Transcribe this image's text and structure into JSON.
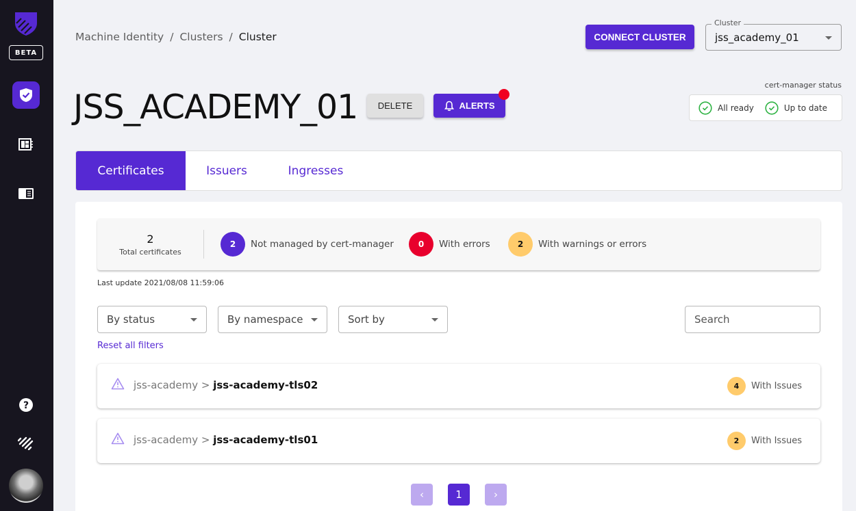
{
  "sidebar": {
    "beta_label": "BETA",
    "items": [
      {
        "name": "certificates-shield",
        "icon": "shield-check-icon",
        "active": true
      },
      {
        "name": "dashboard",
        "icon": "dashboard-icon",
        "active": false
      },
      {
        "name": "docs",
        "icon": "book-icon",
        "active": false
      }
    ],
    "bottom": [
      "help-icon",
      "jetstack-logo-icon",
      "avatar"
    ]
  },
  "breadcrumb": {
    "items": [
      "Machine Identity",
      "Clusters",
      "Cluster"
    ],
    "separator": "/"
  },
  "header": {
    "connect_label": "CONNECT CLUSTER",
    "cluster_select": {
      "label": "Cluster",
      "value": "jss_academy_01"
    },
    "title": "JSS_ACADEMY_01",
    "delete_label": "DELETE",
    "alerts_label": "ALERTS",
    "cert_manager": {
      "label": "cert-manager status",
      "items": [
        "All ready",
        "Up to date"
      ]
    }
  },
  "tabs": [
    {
      "label": "Certificates",
      "active": true
    },
    {
      "label": "Issuers",
      "active": false
    },
    {
      "label": "Ingresses",
      "active": false
    }
  ],
  "summary": {
    "total": "2",
    "total_label": "Total certificates",
    "stats": [
      {
        "count": "2",
        "label": "Not managed by cert-manager",
        "color": "#5629d3"
      },
      {
        "count": "0",
        "label": "With errors",
        "color": "#e8002d"
      },
      {
        "count": "2",
        "label": "With warnings or errors",
        "color": "#ffcb6b"
      }
    ],
    "last_update": "Last update 2021/08/08 11:59:06"
  },
  "filters": {
    "status": "By status",
    "namespace": "By namespace",
    "sort": "Sort by",
    "search_placeholder": "Search",
    "reset_label": "Reset all filters"
  },
  "certificates": [
    {
      "namespace": "jss-academy",
      "separator": ">",
      "name": "jss-academy-tls02",
      "issues": "4",
      "issues_label": "With Issues"
    },
    {
      "namespace": "jss-academy",
      "separator": ">",
      "name": "jss-academy-tls01",
      "issues": "2",
      "issues_label": "With Issues"
    }
  ],
  "pagination": {
    "prev": "‹",
    "current": "1",
    "next": "›"
  },
  "colors": {
    "accent": "#5629d3",
    "sidebar": "#17151f",
    "error": "#e8002d",
    "warning": "#ffcb6b",
    "ok": "#2fb344"
  }
}
